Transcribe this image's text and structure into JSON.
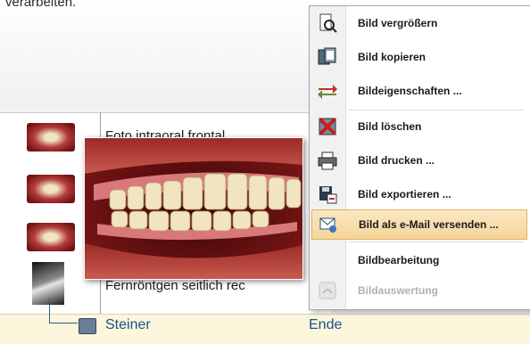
{
  "top_text": "verarbeiten.",
  "rows": [
    {
      "label": "Foto intraoral frontal"
    },
    {
      "label": ""
    },
    {
      "label": ""
    },
    {
      "label": "Fernröntgen seitlich rec"
    }
  ],
  "tree": {
    "child_label": "Steiner",
    "second_col_label": "Ende"
  },
  "context_menu": {
    "items": [
      {
        "label": "Bild vergrößern",
        "icon": "magnifier-page-icon"
      },
      {
        "label": "Bild kopieren",
        "icon": "copy-icon"
      },
      {
        "label": "Bildeigenschaften ...",
        "icon": "properties-arrows-icon"
      },
      {
        "label": "Bild löschen",
        "icon": "delete-x-icon"
      },
      {
        "label": "Bild drucken ...",
        "icon": "printer-icon"
      },
      {
        "label": "Bild exportieren ...",
        "icon": "export-disk-icon"
      },
      {
        "label": "Bild als e-Mail versenden ...",
        "icon": "email-icon",
        "highlighted": true
      },
      {
        "label": "Bildbearbeitung",
        "icon": ""
      },
      {
        "label": "Bildauswertung",
        "icon": "analysis-icon",
        "disabled": true
      }
    ]
  },
  "colors": {
    "highlight": "#f6d49a",
    "link_blue": "#1d4f8c",
    "bottom_strip": "#fbf6dc"
  }
}
